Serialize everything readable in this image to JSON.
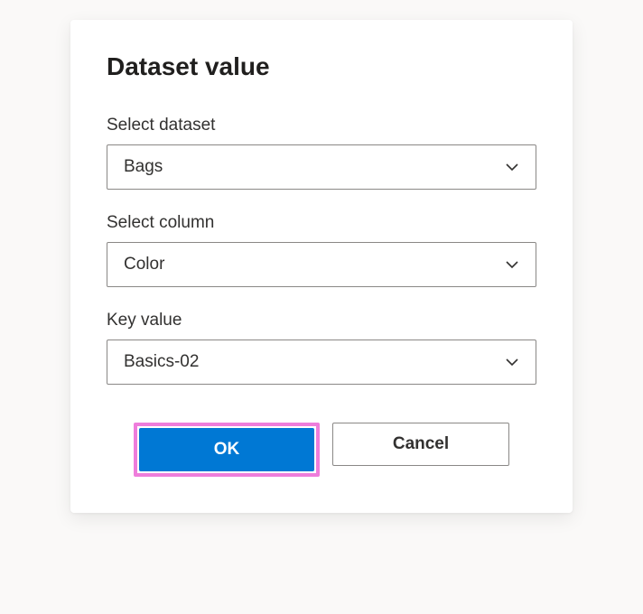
{
  "dialog": {
    "title": "Dataset value",
    "fields": {
      "dataset": {
        "label": "Select dataset",
        "value": "Bags"
      },
      "column": {
        "label": "Select column",
        "value": "Color"
      },
      "key": {
        "label": "Key value",
        "value": "Basics-02"
      }
    },
    "buttons": {
      "ok": "OK",
      "cancel": "Cancel"
    }
  }
}
